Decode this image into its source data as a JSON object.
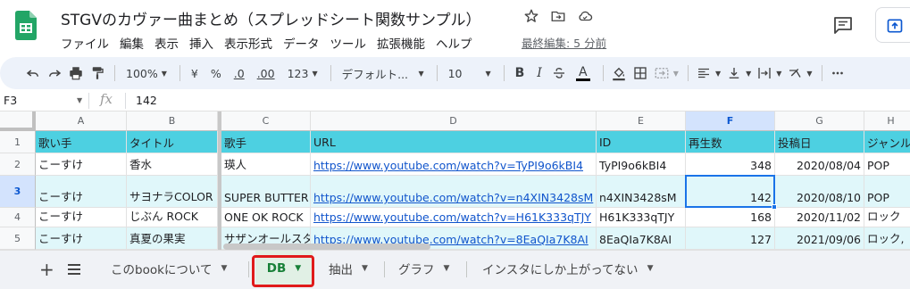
{
  "doc": {
    "title": "STGVのカヴァー曲まとめ（スプレッドシート関数サンプル）",
    "last_edit": "最終編集: 5 分前"
  },
  "menu": [
    "ファイル",
    "編集",
    "表示",
    "挿入",
    "表示形式",
    "データ",
    "ツール",
    "拡張機能",
    "ヘルプ"
  ],
  "toolbar": {
    "zoom": "100%",
    "currency": "¥",
    "percent": "%",
    "dec_decrease": ".0",
    "dec_increase": ".00",
    "number_format": "123",
    "font": "デフォルト...",
    "font_size": "10",
    "bold": "B",
    "italic": "I",
    "text_color": "A"
  },
  "formula_bar": {
    "cell_ref": "F3",
    "fx": "fx",
    "value": "142"
  },
  "grid": {
    "columns": [
      "A",
      "B",
      "C",
      "D",
      "E",
      "F",
      "G",
      "H"
    ],
    "rows": [
      "1",
      "2",
      "3",
      "4",
      "5"
    ],
    "header": [
      "歌い手",
      "タイトル",
      "歌手",
      "URL",
      "ID",
      "再生数",
      "投稿日",
      "ジャンル"
    ],
    "data": [
      [
        "こーすけ",
        "香水",
        "瑛人",
        "https://www.youtube.com/watch?v=TyPI9o6kBI4",
        "TyPI9o6kBI4",
        "348",
        "2020/08/04",
        "POP"
      ],
      [
        "こーすけ",
        "サヨナラCOLOR",
        "SUPER BUTTER DOG",
        "https://www.youtube.com/watch?v=n4XIN3428sM",
        "n4XIN3428sM",
        "142",
        "2020/08/10",
        "POP"
      ],
      [
        "こーすけ",
        "じぶん ROCK",
        "ONE OK ROCK",
        "https://www.youtube.com/watch?v=H61K333qTJY",
        "H61K333qTJY",
        "168",
        "2020/11/02",
        "ロック"
      ],
      [
        "こーすけ",
        "真夏の果実",
        "サザンオールスターズ",
        "https://www.youtube.com/watch?v=8EaQIa7K8AI",
        "8EaQIa7K8AI",
        "127",
        "2021/09/06",
        "ロック,"
      ]
    ]
  },
  "sheets": {
    "add": "+",
    "tabs": [
      "このbookについて",
      "DB",
      "抽出",
      "グラフ",
      "インスタにしか上がってない"
    ],
    "active": "DB"
  },
  "colors": {
    "header_fill": "#4dd0e1",
    "band_fill": "#e0f7fa",
    "selection": "#1a73e8",
    "active_tab": "#188038",
    "highlight": "#e01b1b"
  },
  "icons": [
    "sheets-logo",
    "star-icon",
    "folder-move-icon",
    "cloud-status-icon",
    "comment-icon",
    "share-icon",
    "undo-icon",
    "redo-icon",
    "print-icon",
    "paint-format-icon",
    "fill-color-icon",
    "borders-icon",
    "merge-icon",
    "align-icon",
    "valign-icon",
    "wrap-icon",
    "rotate-icon",
    "more-icon",
    "list-sheets-icon"
  ]
}
